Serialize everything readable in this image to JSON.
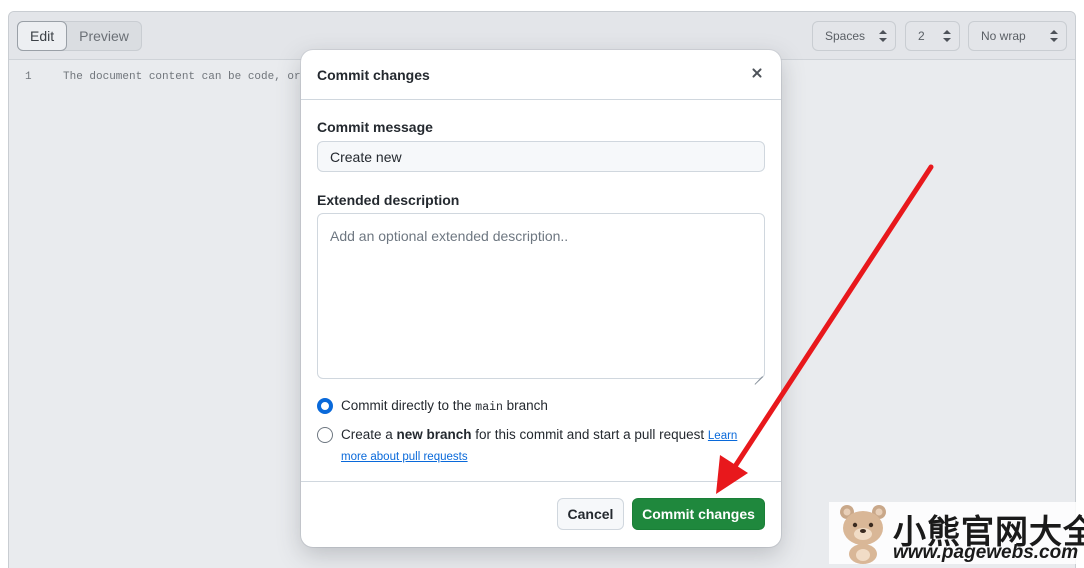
{
  "editor": {
    "tabs": [
      {
        "label": "Edit",
        "active": true
      },
      {
        "label": "Preview",
        "active": false
      }
    ],
    "indent_mode": "Spaces",
    "indent_size": "2",
    "wrap_mode": "No wrap",
    "line_number": "1",
    "line_text": "The document content can be code, or"
  },
  "modal": {
    "title": "Commit changes",
    "commit_message_label": "Commit message",
    "commit_message_value": "Create new",
    "extended_label": "Extended description",
    "extended_placeholder": "Add an optional extended description..",
    "option_direct": {
      "prefix": "Commit directly to the ",
      "branch": "main",
      "suffix": " branch",
      "checked": true
    },
    "option_new": {
      "prefix": "Create a ",
      "bold": "new branch",
      "suffix": " for this commit and start a pull request ",
      "link": "Learn more about pull requests",
      "checked": false
    },
    "cancel_label": "Cancel",
    "commit_label": "Commit changes"
  },
  "watermark": {
    "text": "小熊官网大全",
    "url": "www.pagewebs.com"
  },
  "colors": {
    "primary_button": "#1f883d",
    "accent_blue": "#0969da",
    "annotation_red": "#e8181c"
  },
  "icons": {
    "close": "close-icon",
    "select_arrows": "updown-chevron-icon"
  }
}
